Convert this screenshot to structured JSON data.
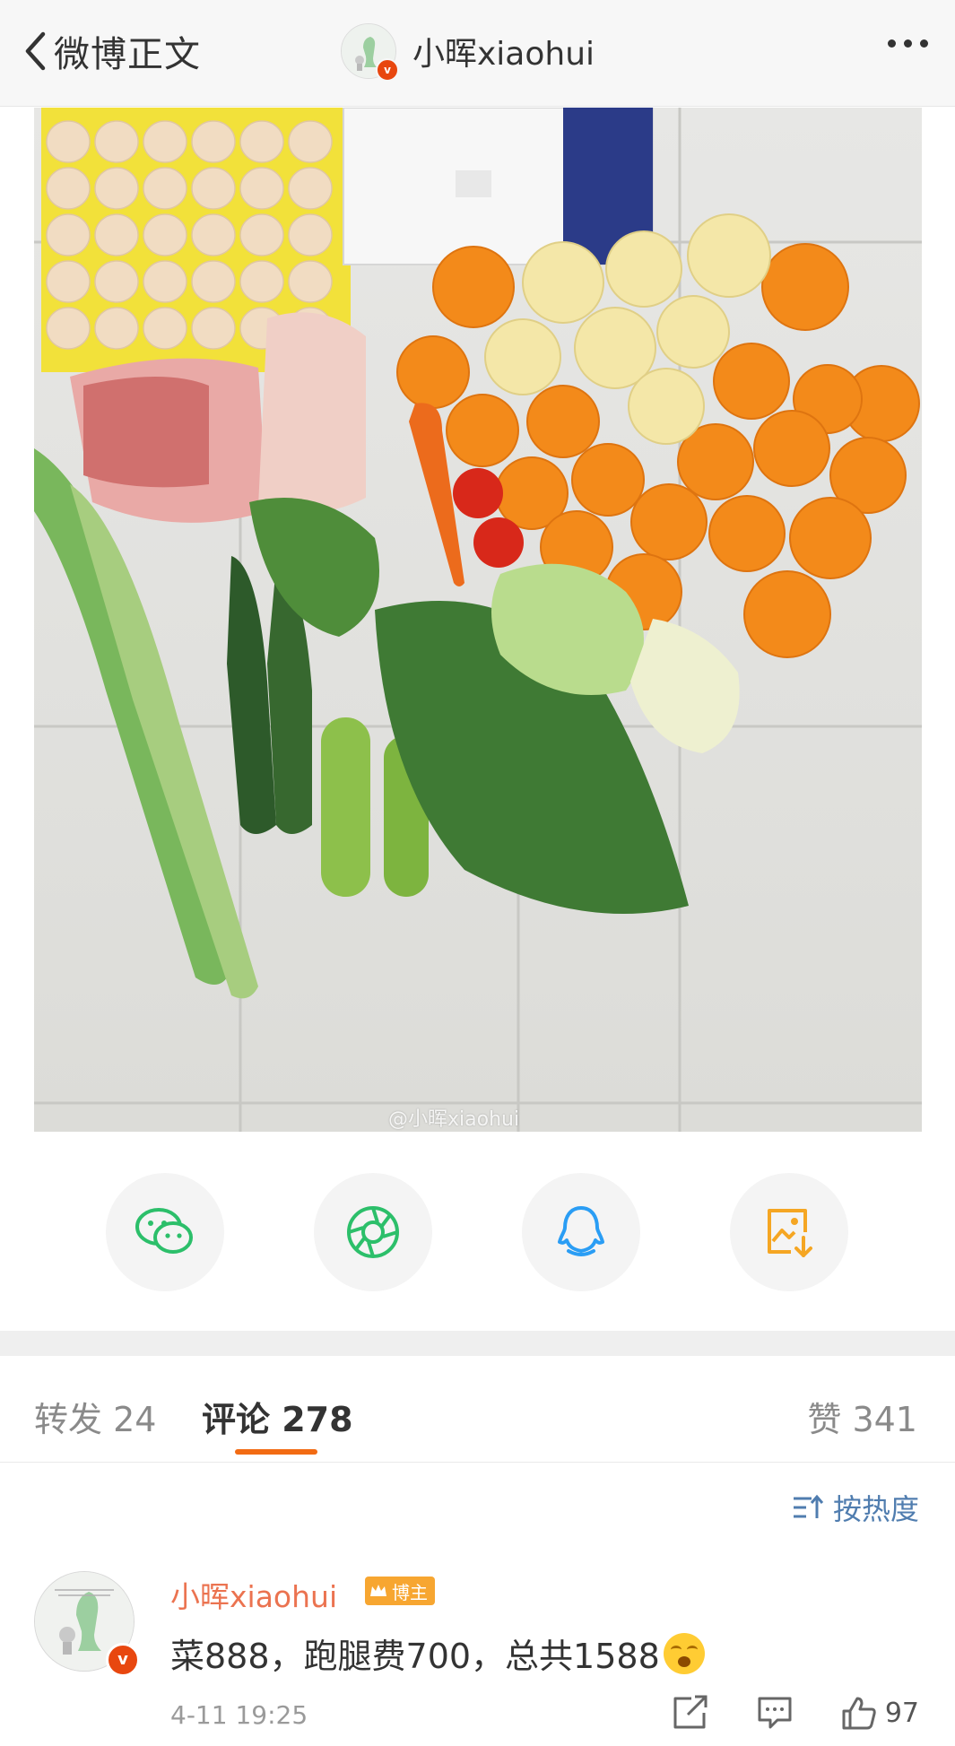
{
  "header": {
    "back_label": "微博正文",
    "author_name": "小晖xiaohui"
  },
  "post": {
    "watermark": "@小晖xiaohui"
  },
  "share": {
    "items": [
      {
        "icon": "wechat-icon",
        "color": "#2cbf6a"
      },
      {
        "icon": "moments-icon",
        "color": "#2cbf6a"
      },
      {
        "icon": "qq-icon",
        "color": "#2a9df4"
      },
      {
        "icon": "save-image-icon",
        "color": "#f5a623"
      }
    ]
  },
  "tabs": {
    "repost": "转发 24",
    "comments": "评论 278",
    "likes": "赞 341"
  },
  "sort": {
    "label": "按热度"
  },
  "comment": {
    "author": "小晖xiaohui",
    "badge": "博主",
    "text": "菜888，跑腿费700，总共1588",
    "emoji": "crying-face-icon",
    "time": "4-11 19:25",
    "like_count": "97"
  },
  "colors": {
    "accent_orange": "#f26b13",
    "link_blue": "#507daf",
    "name_orange": "#eb7350"
  }
}
